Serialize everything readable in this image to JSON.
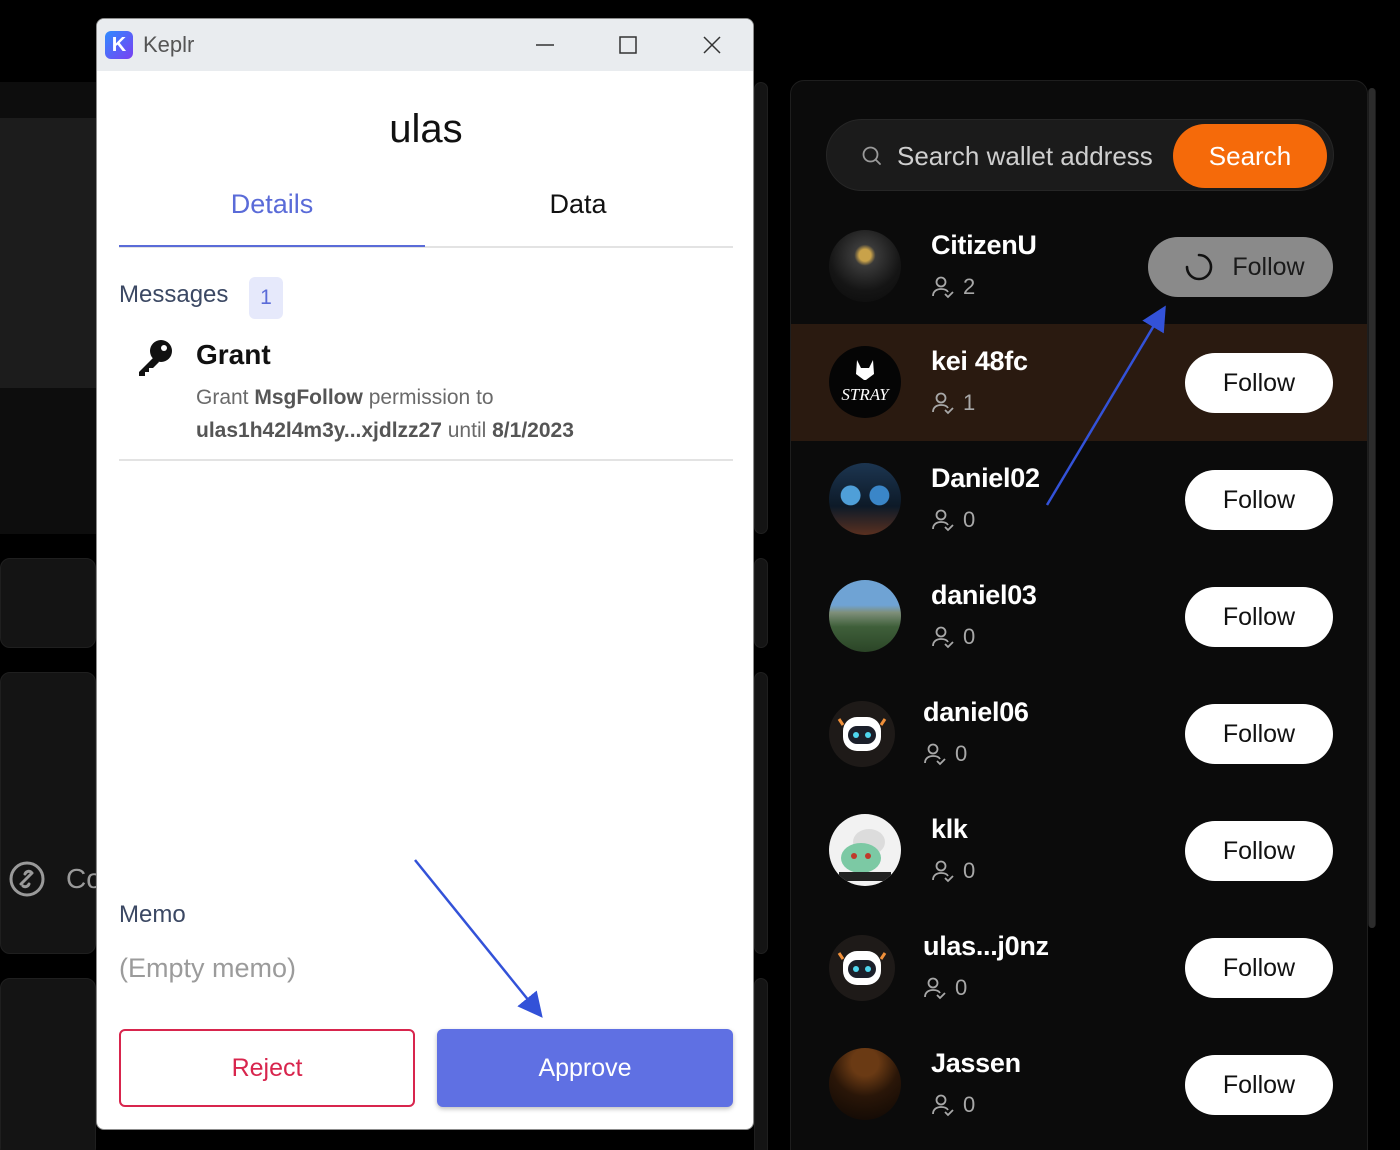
{
  "background": {
    "partial_text": "Co"
  },
  "right_panel": {
    "search": {
      "placeholder": "Search wallet address",
      "button_label": "Search"
    },
    "users": [
      {
        "name": "CitizenU",
        "count": "2",
        "button": "Follow",
        "state": "loading"
      },
      {
        "name": "kei 48fc",
        "count": "1",
        "button": "Follow",
        "state": "highlighted"
      },
      {
        "name": "Daniel02",
        "count": "0",
        "button": "Follow"
      },
      {
        "name": "daniel03",
        "count": "0",
        "button": "Follow"
      },
      {
        "name": "daniel06",
        "count": "0",
        "button": "Follow"
      },
      {
        "name": "klk",
        "count": "0",
        "button": "Follow"
      },
      {
        "name": "ulas...j0nz",
        "count": "0",
        "button": "Follow"
      },
      {
        "name": "Jassen",
        "count": "0",
        "button": "Follow"
      }
    ],
    "accent_color": "#f56a0a"
  },
  "keplr": {
    "window_title": "Keplr",
    "signer": "ulas",
    "tabs": [
      "Details",
      "Data"
    ],
    "active_tab": "Details",
    "messages_label": "Messages",
    "messages_count": "1",
    "message": {
      "icon": "key-icon",
      "title": "Grant",
      "text_1": "Grant ",
      "msg_type": "MsgFollow",
      "text_2": " permission to",
      "grantee": "ulas1h42l4m3y...xjdlzz27",
      "text_3": " until ",
      "until": "8/1/2023"
    },
    "memo_label": "Memo",
    "memo_value": "(Empty memo)",
    "reject_label": "Reject",
    "approve_label": "Approve",
    "accent_color": "#5f70e3"
  }
}
